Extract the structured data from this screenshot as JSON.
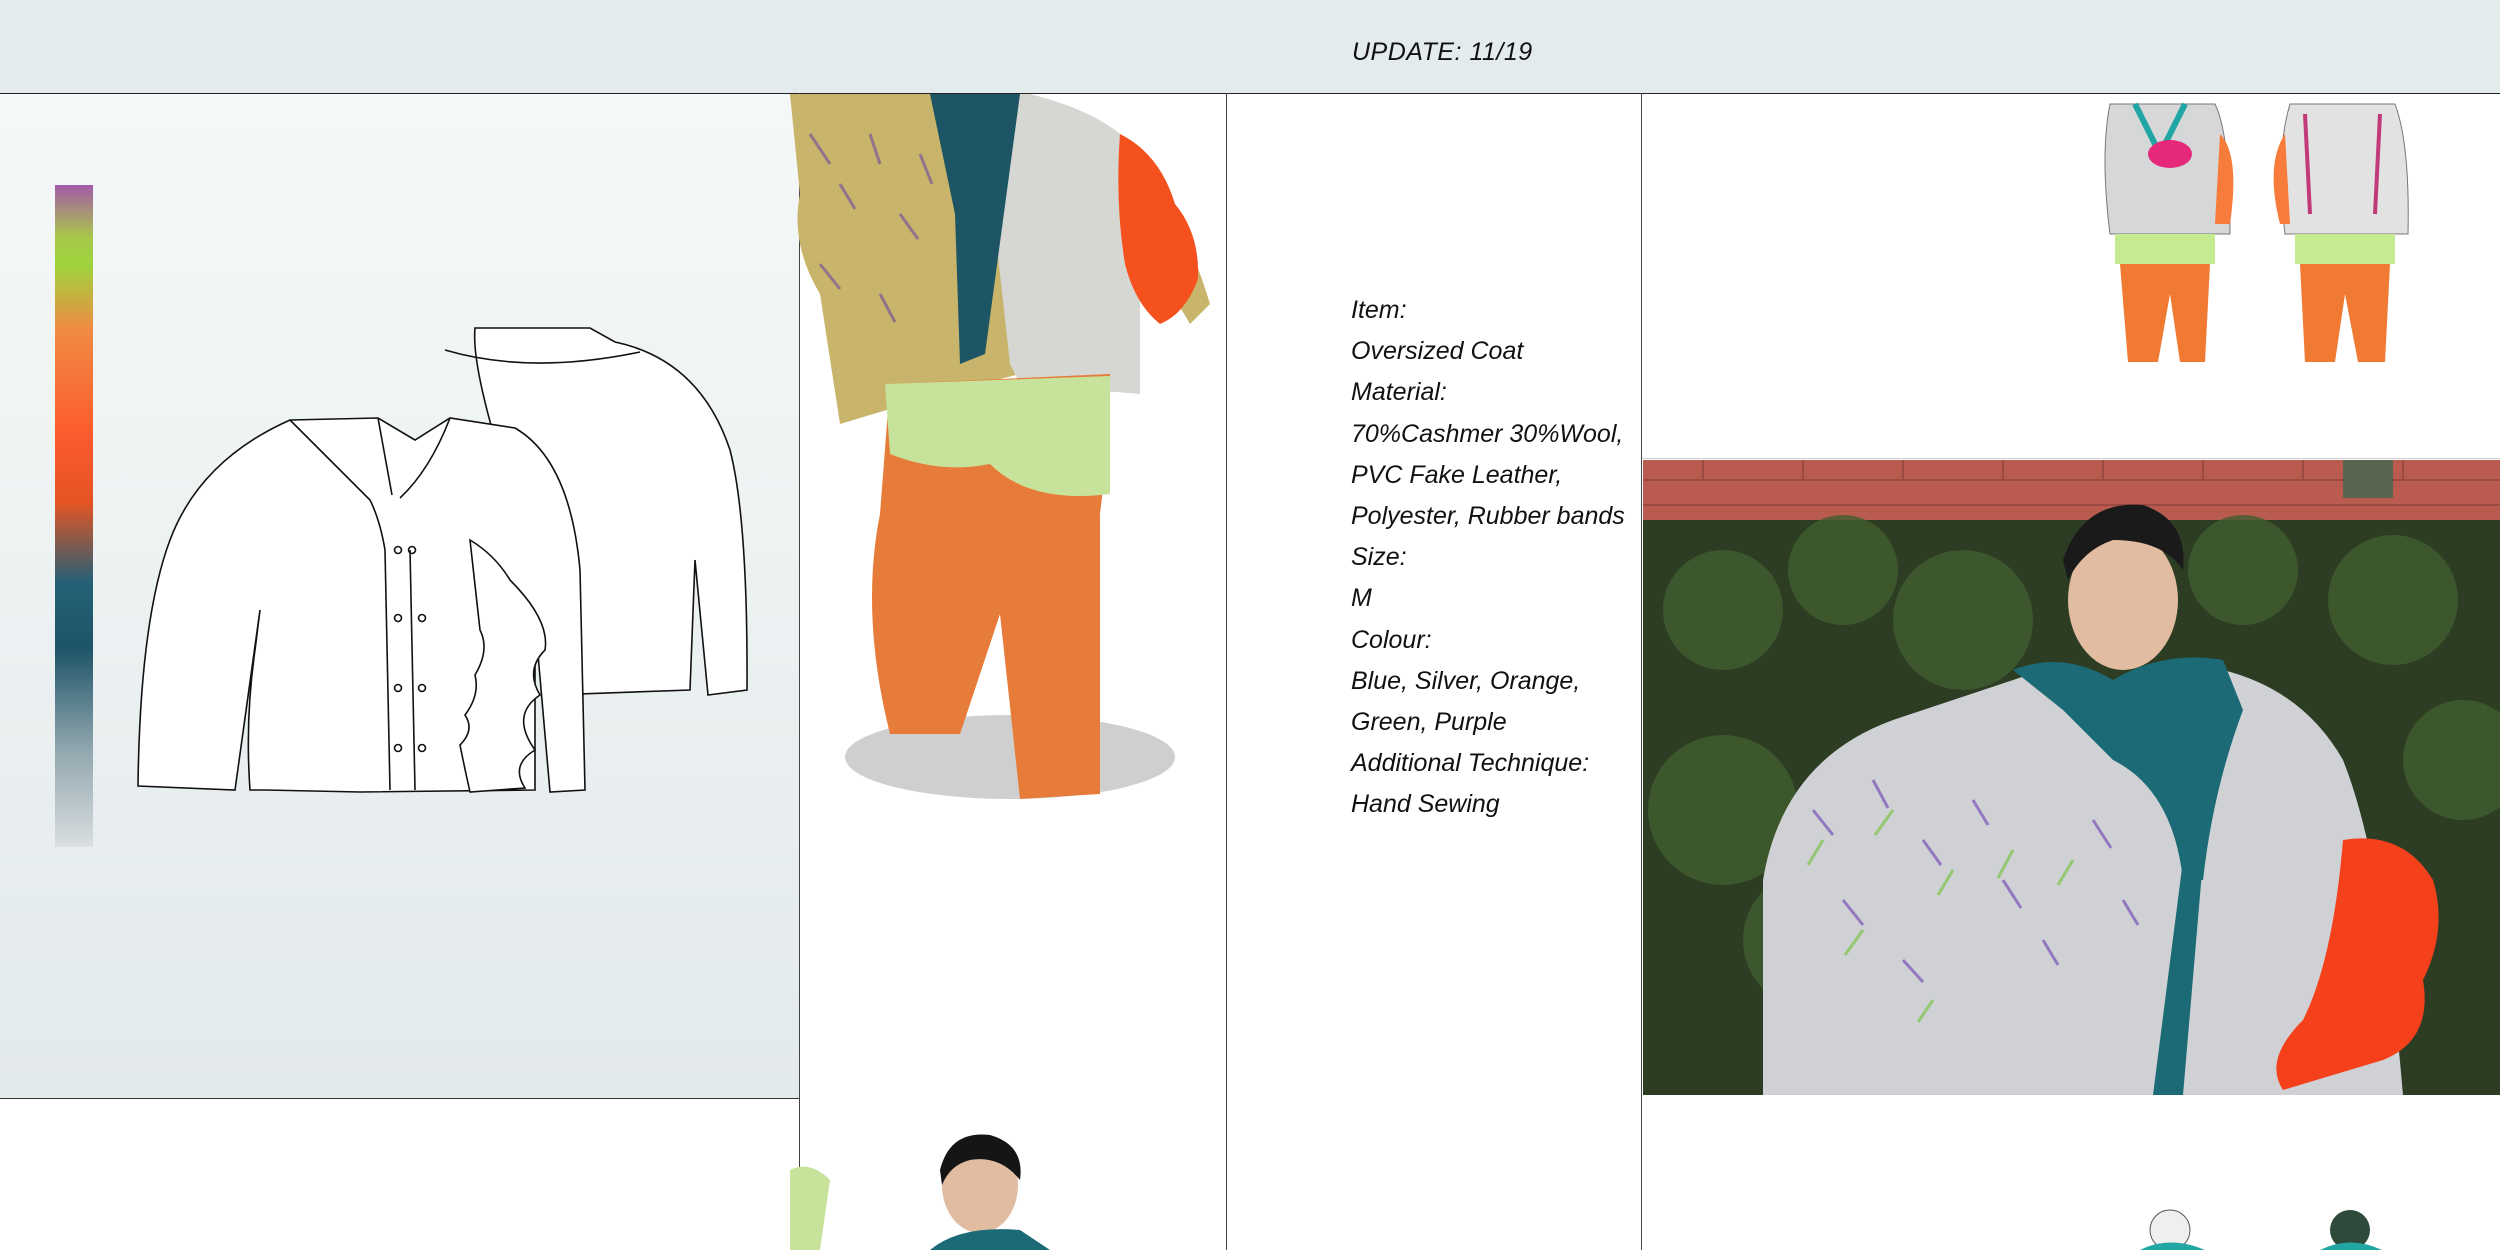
{
  "header": {
    "update": "UPDATE: 11/19"
  },
  "details": {
    "lines": [
      "Item:",
      "Oversized Coat",
      "Material:",
      "70%Cashmer 30%Wool,",
      "PVC Fake Leather,",
      "Polyester, Rubber  bands",
      "Size:",
      "M",
      "Colour:",
      "Blue, Silver, Orange,",
      "Green, Purple",
      "Additional Technique:",
      "Hand Sewing"
    ]
  },
  "palette": {
    "colors": [
      "#a45aa8",
      "#9dd43d",
      "#f28a43",
      "#fb5a2d",
      "#256176",
      "#dadfe1"
    ]
  },
  "icons": {
    "sketch": "coat-flat-sketch",
    "model_full": "model-full-body-photo",
    "model_seated": "model-seated-photo",
    "illustration": "fashion-illustration"
  }
}
